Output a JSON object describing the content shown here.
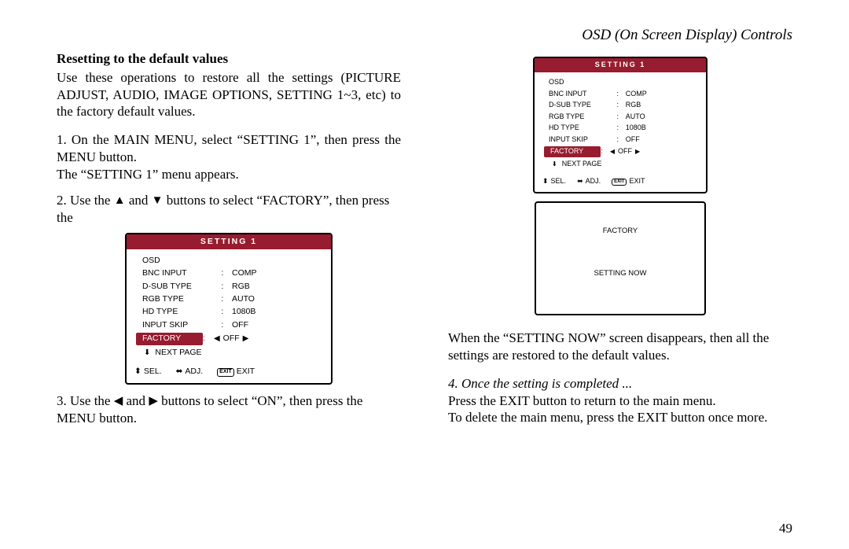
{
  "header": "OSD (On Screen Display) Controls",
  "page_number": "49",
  "left": {
    "heading": "Resetting to the default values",
    "intro": "Use these operations to restore all the settings (PICTURE ADJUST, AUDIO, IMAGE OPTIONS, SETTING 1~3, etc) to the factory default values.",
    "step1a": "1. On the MAIN MENU, select “SETTING 1”, then press the MENU button.",
    "step1b": "The “SETTING 1” menu appears.",
    "step2_pre": "2. Use the ",
    "step2_mid": " and ",
    "step2_post": " buttons to select “FACTORY”, then press the",
    "step3_pre": "3. Use the ",
    "step3_mid": " and ",
    "step3_post": " buttons to select “ON”, then press the MENU button."
  },
  "right": {
    "after_now": "When the “SETTING NOW” screen disappears, then all the settings are restored to the default values.",
    "step4_heading": "4. Once the setting is completed ...",
    "step4a": "Press the EXIT button to return to the main menu.",
    "step4b": "To delete the main menu, press the EXIT button once more."
  },
  "osd": {
    "title": "SETTING 1",
    "rows": [
      {
        "label": "OSD",
        "colon": "",
        "val": ""
      },
      {
        "label": "BNC INPUT",
        "colon": ":",
        "val": "COMP"
      },
      {
        "label": "D-SUB TYPE",
        "colon": ":",
        "val": "RGB"
      },
      {
        "label": "RGB TYPE",
        "colon": ":",
        "val": "AUTO"
      },
      {
        "label": "HD TYPE",
        "colon": ":",
        "val": "1080B"
      },
      {
        "label": "INPUT SKIP",
        "colon": ":",
        "val": "OFF"
      }
    ],
    "factory": {
      "label": "FACTORY",
      "colon": ":",
      "val": "OFF"
    },
    "nextpage": "NEXT PAGE",
    "footer": {
      "sel": "SEL.",
      "adj": "ADJ.",
      "exit_box": "EXIT",
      "exit": "EXIT"
    }
  },
  "factory_box": {
    "line1": "FACTORY",
    "line2": "SETTING NOW"
  }
}
